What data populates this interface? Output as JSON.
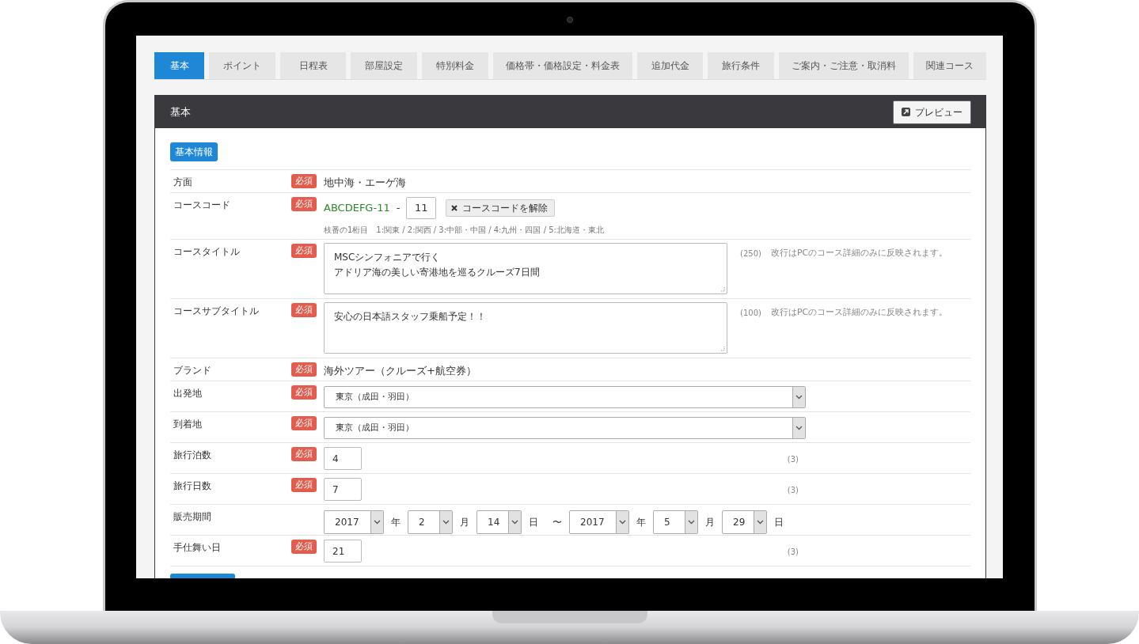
{
  "tabs": [
    {
      "label": "基本",
      "selected": true
    },
    {
      "label": "ポイント",
      "selected": false
    },
    {
      "label": "日程表",
      "selected": false
    },
    {
      "label": "部屋設定",
      "selected": false
    },
    {
      "label": "特別料金",
      "selected": false
    },
    {
      "label": "価格帯・価格設定・料金表",
      "selected": false
    },
    {
      "label": "追加代金",
      "selected": false
    },
    {
      "label": "旅行条件",
      "selected": false
    },
    {
      "label": "ご案内・ご注意・取消料",
      "selected": false
    },
    {
      "label": "関連コース",
      "selected": false
    }
  ],
  "panel": {
    "title": "基本",
    "preview_button": "プレビュー",
    "section_button": "基本情報",
    "fields": [
      {
        "kind": "text",
        "label": "方面",
        "badge": "必須",
        "value": "地中海・エーゲ海"
      },
      {
        "kind": "code",
        "label": "コースコード",
        "badge": "必須",
        "prefix": "ABCDEFG-11",
        "separator": "-",
        "value": "11",
        "clear_button": "コースコードを解除",
        "hint": "枝番の1桁目　1:関東 / 2:関西 / 3:中部・中国 / 4:九州・四国 / 5:北海道・東北"
      },
      {
        "kind": "textarea",
        "label": "コースタイトル",
        "badge": "必須",
        "lines": [
          "MSCシンフォニアで行く",
          "アドリア海の美しい寄港地を巡るクルーズ7日間"
        ],
        "counter": "(250)",
        "note": "改行はPCのコース詳細のみに反映されます。"
      },
      {
        "kind": "textarea",
        "label": "コースサブタイトル",
        "badge": "必須",
        "lines": [
          "安心の日本語スタッフ乗船予定！！"
        ],
        "counter": "(100)",
        "note": "改行はPCのコース詳細のみに反映されます。"
      },
      {
        "kind": "text",
        "label": "ブランド",
        "badge": "必須",
        "value": "海外ツアー（クルーズ+航空券）"
      },
      {
        "kind": "select",
        "label": "出発地",
        "badge": "必須",
        "value": "東京（成田・羽田）"
      },
      {
        "kind": "select",
        "label": "到着地",
        "badge": "必須",
        "value": "東京（成田・羽田）"
      },
      {
        "kind": "number",
        "label": "旅行泊数",
        "badge": "必須",
        "value": "4",
        "counter": "(3)"
      },
      {
        "kind": "number",
        "label": "旅行日数",
        "badge": "必須",
        "value": "7",
        "counter": "(3)"
      },
      {
        "kind": "period",
        "label": "販売期間",
        "parts": [
          {
            "kind": "year",
            "value": "2017"
          },
          {
            "kind": "unit",
            "text": "年"
          },
          {
            "kind": "day",
            "value": "2"
          },
          {
            "kind": "unit",
            "text": "月"
          },
          {
            "kind": "day",
            "value": "14"
          },
          {
            "kind": "unit",
            "text": "日"
          },
          {
            "kind": "unit",
            "text": "〜"
          },
          {
            "kind": "year",
            "value": "2017"
          },
          {
            "kind": "unit",
            "text": "年"
          },
          {
            "kind": "day",
            "value": "5"
          },
          {
            "kind": "unit",
            "text": "月"
          },
          {
            "kind": "day",
            "value": "29"
          },
          {
            "kind": "unit",
            "text": "日"
          }
        ]
      },
      {
        "kind": "number",
        "label": "手仕舞い日",
        "badge": "必須",
        "value": "21",
        "counter": "(3)"
      }
    ]
  }
}
